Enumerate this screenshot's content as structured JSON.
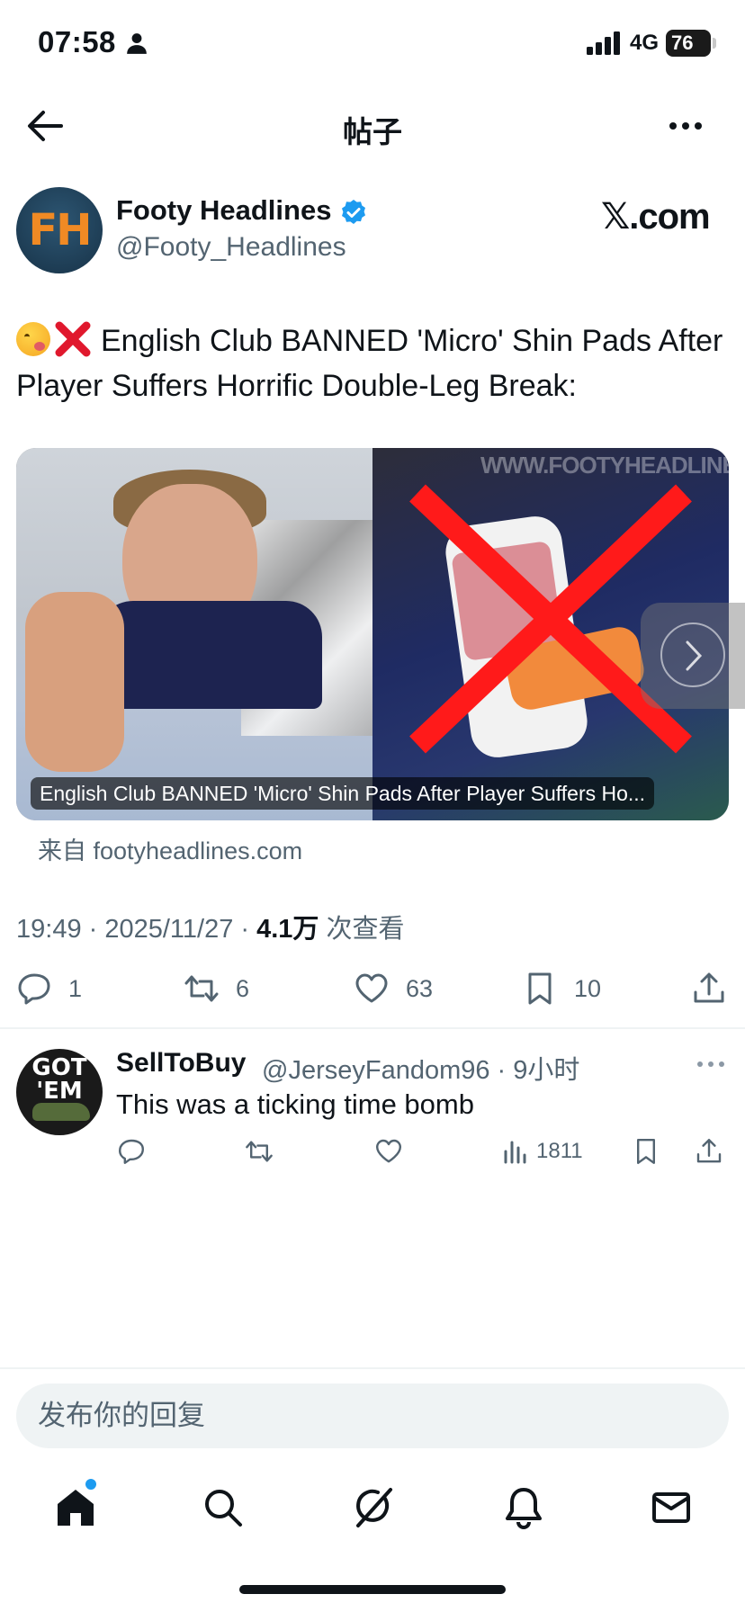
{
  "status_bar": {
    "time": "07:58",
    "network": "4G",
    "battery": "76"
  },
  "header": {
    "title": "帖子"
  },
  "tweet": {
    "author_name": "Footy Headlines",
    "author_handle": "@Footy_Headlines",
    "avatar_text": "FH",
    "source_logo": "𝕏.com",
    "text": "English Club BANNED 'Micro' Shin Pads After Player Suffers Horrific Double-Leg Break:",
    "media_watermark": "WWW.FOOTYHEADLINES.COM",
    "media_caption": "English Club BANNED 'Micro' Shin Pads After Player Suffers Ho...",
    "media_source": "来自 footyheadlines.com",
    "time_date": "19:49 · 2025/11/27 · ",
    "views_count": "4.1万",
    "views_label": " 次查看",
    "replies": "1",
    "reposts": "6",
    "likes": "63",
    "bookmarks": "10"
  },
  "reply": {
    "name": "SellToBuy",
    "handle_time": "@JerseyFandom96 · 9小时",
    "avatar_text": "GOT 'EM",
    "text": "This was a ticking time bomb",
    "views": "1811"
  },
  "composer": {
    "placeholder": "发布你的回复"
  },
  "colors": {
    "accent": "#1d9bf0",
    "secondary_text": "#536471",
    "primary_text": "#0f1419"
  }
}
